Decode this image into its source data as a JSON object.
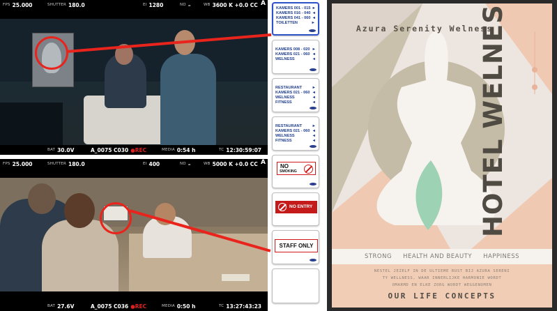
{
  "monitor_top": {
    "top_bar": {
      "fps_label": "FPS",
      "fps": "25.000",
      "shutter_label": "SHUTTER",
      "shutter": "180.0",
      "ei_label": "EI",
      "ei": "1280",
      "nd_label": "ND",
      "nd": "–",
      "wb_label": "WB",
      "wb": "3600 K +0.0 CC",
      "camera": "A"
    },
    "bottom_bar": {
      "bat_label": "BAT",
      "bat": "30.0V",
      "clip": "A_0075  C030",
      "rec": "●REC",
      "media_label": "MEDIA",
      "media": "0:54 h",
      "tc_label": "TC",
      "tc": "12:30:59:07"
    }
  },
  "monitor_bottom": {
    "top_bar": {
      "fps_label": "FPS",
      "fps": "25.000",
      "shutter_label": "SHUTTER",
      "shutter": "180.0",
      "ei_label": "EI",
      "ei": "400",
      "nd_label": "ND",
      "nd": "–",
      "wb_label": "WB",
      "wb": "5000 K +0.0 CC",
      "camera": "A"
    },
    "bottom_bar": {
      "bat_label": "BAT",
      "bat": "27.6V",
      "clip": "A_0075  C036",
      "rec": "●REC",
      "media_label": "MEDIA",
      "media": "0:50 h",
      "tc_label": "TC",
      "tc": "13:27:43:23"
    }
  },
  "signs": [
    {
      "lines": [
        [
          "KAMERS 001 - 015",
          "►"
        ],
        [
          "KAMERS 016 - 040",
          "◄"
        ],
        [
          "KAMERS 041 - 060",
          "◄"
        ],
        [
          "TOILETTEN",
          "►"
        ]
      ]
    },
    {
      "lines": [
        [
          "KAMERS 008 - 020",
          "►"
        ],
        [
          "KAMERS 021 - 060",
          "◄"
        ],
        [
          "WELNESS",
          "◄"
        ]
      ]
    },
    {
      "lines": [
        [
          "RESTAURANT",
          "►"
        ],
        [
          "KAMERS 021 - 060",
          "◄"
        ],
        [
          "WELNESS",
          "◄"
        ],
        [
          "FITNESS",
          "◄"
        ]
      ]
    },
    {
      "lines": [
        [
          "RESTAURANT",
          "►"
        ],
        [
          "KAMERS 021 - 060",
          "◄"
        ],
        [
          "WELNESS",
          "◄"
        ],
        [
          "FITNESS",
          "◄"
        ]
      ]
    },
    {
      "no": "NO",
      "text": "SMOKING"
    },
    {
      "text": "NO ENTRY"
    },
    {
      "text": "STAFF ONLY"
    }
  ],
  "poster": {
    "brand": "Azura Serenity Welness",
    "vertical_title": "HOTEL WELNESS",
    "tags": [
      "STRONG",
      "HEALTH AND BEAUTY",
      "HAPPINESS"
    ],
    "desc_1": "NESTEL JEZELF IN DE ULTIEME RUST BIJ AZURA SERENI",
    "desc_2": "TY WELLNESS, WAAR INNERLIJKE HARMONIE WORDT",
    "desc_3": "OMARMD EN ELKE ZORG WORDT WEGGENOMEN",
    "footer": "OUR LIFE CONCEPTS"
  },
  "colors": {
    "highlight": "#e8241c",
    "sign_text": "#1f3d8f",
    "poster_bg": "#ede5df",
    "poster_peach": "#f0c9b2",
    "poster_taupe": "#bdb49e",
    "poster_leaf": "#9ed2b4"
  }
}
